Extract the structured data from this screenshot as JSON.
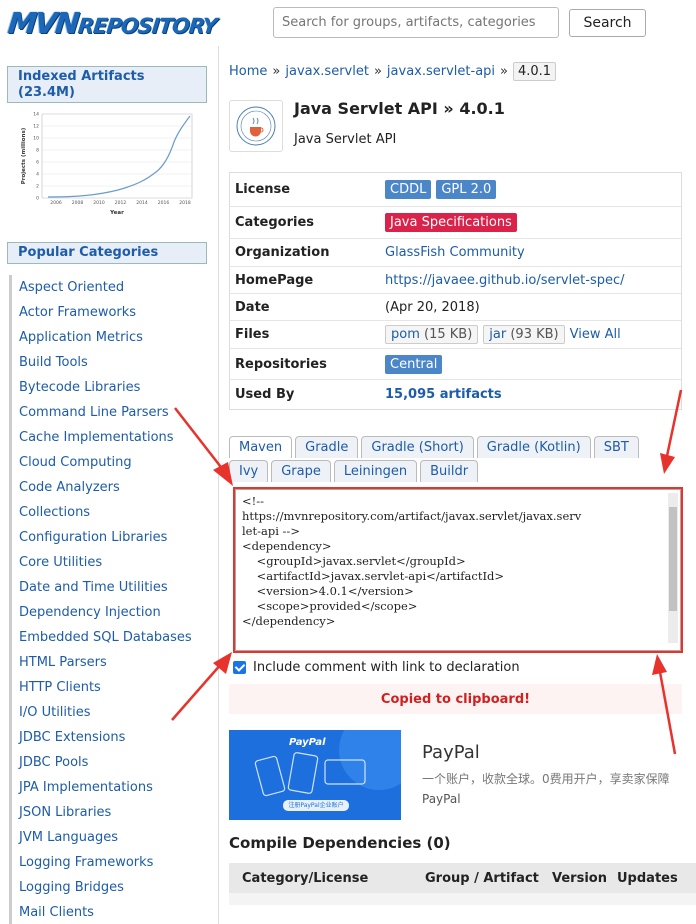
{
  "header": {
    "logo_mvn": "MVN",
    "logo_repo": "REPOSITORY",
    "search_placeholder": "Search for groups, artifacts, categories",
    "search_button": "Search"
  },
  "sidebar": {
    "indexed_title": "Indexed Artifacts (23.4M)",
    "chart": {
      "ylabel": "Projects (millions)",
      "xlabel": "Year",
      "yticks": [
        "0",
        "2",
        "4",
        "6",
        "8",
        "10",
        "12",
        "14"
      ],
      "xticks": [
        "2006",
        "2008",
        "2010",
        "2012",
        "2014",
        "2016",
        "2018"
      ]
    },
    "popular_title": "Popular Categories",
    "categories": [
      "Aspect Oriented",
      "Actor Frameworks",
      "Application Metrics",
      "Build Tools",
      "Bytecode Libraries",
      "Command Line Parsers",
      "Cache Implementations",
      "Cloud Computing",
      "Code Analyzers",
      "Collections",
      "Configuration Libraries",
      "Core Utilities",
      "Date and Time Utilities",
      "Dependency Injection",
      "Embedded SQL Databases",
      "HTML Parsers",
      "HTTP Clients",
      "I/O Utilities",
      "JDBC Extensions",
      "JDBC Pools",
      "JPA Implementations",
      "JSON Libraries",
      "JVM Languages",
      "Logging Frameworks",
      "Logging Bridges",
      "Mail Clients"
    ]
  },
  "breadcrumb": {
    "home": "Home",
    "group": "javax.servlet",
    "artifact": "javax.servlet-api",
    "version": "4.0.1",
    "sep": "»"
  },
  "artifact": {
    "title": "Java Servlet API » 4.0.1",
    "subtitle": "Java Servlet API"
  },
  "info": {
    "license_label": "License",
    "license_tags": [
      "CDDL",
      "GPL 2.0"
    ],
    "categories_label": "Categories",
    "categories_tag": "Java Specifications",
    "org_label": "Organization",
    "org_value": "GlassFish Community",
    "homepage_label": "HomePage",
    "homepage_value": "https://javaee.github.io/servlet-spec/",
    "date_label": "Date",
    "date_value": "(Apr 20, 2018)",
    "files_label": "Files",
    "files": {
      "pom": "pom",
      "pom_size": "(15 KB)",
      "jar": "jar",
      "jar_size": "(93 KB)",
      "view_all": "View All"
    },
    "repos_label": "Repositories",
    "repos_tag": "Central",
    "usedby_label": "Used By",
    "usedby_value": "15,095 artifacts"
  },
  "tabs_row1": [
    "Maven",
    "Gradle",
    "Gradle (Short)",
    "Gradle (Kotlin)",
    "SBT"
  ],
  "tabs_row2": [
    "Ivy",
    "Grape",
    "Leiningen",
    "Buildr"
  ],
  "snippet": "<!--\nhttps://mvnrepository.com/artifact/javax.servlet/javax.serv\nlet-api -->\n<dependency>\n    <groupId>javax.servlet</groupId>\n    <artifactId>javax.servlet-api</artifactId>\n    <version>4.0.1</version>\n    <scope>provided</scope>\n</dependency>",
  "include_comment": "Include comment with link to declaration",
  "copied": "Copied to clipboard!",
  "ad": {
    "title": "PayPal",
    "desc": "一个账户，收款全球。0费用开户，享卖家保障",
    "brand": "PayPal",
    "img_logo": "PayPal",
    "img_btn": "注册PayPal企业账户"
  },
  "deps": {
    "title": "Compile Dependencies (0)",
    "headers": [
      "Category/License",
      "Group / Artifact",
      "Version",
      "Updates"
    ]
  },
  "colors": {
    "link": "#1d5ca8",
    "tag_blue": "#4a86c8",
    "tag_red": "#d9234b",
    "annotation_red": "#e8322c"
  }
}
